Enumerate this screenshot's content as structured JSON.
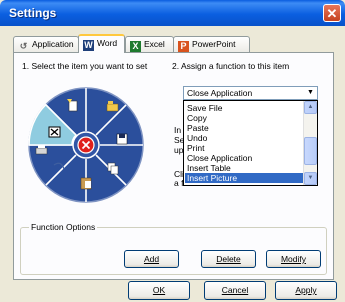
{
  "window": {
    "title": "Settings"
  },
  "tabs": [
    {
      "label": "Application",
      "icon": "application-icon"
    },
    {
      "label": "Word",
      "icon": "word-icon"
    },
    {
      "label": "Excel",
      "icon": "excel-icon"
    },
    {
      "label": "PowerPoint",
      "icon": "powerpoint-icon"
    }
  ],
  "active_tab": "Word",
  "step1_label": "1. Select the item you want to set",
  "step2_label": "2. Assign a function to this item",
  "combo": {
    "value": "Close Application"
  },
  "dropdown_items": [
    "Save File",
    "Copy",
    "Paste",
    "Undo",
    "Print",
    "Close Application",
    "Insert Table",
    "Insert Picture"
  ],
  "dropdown_selected": "Insert Picture",
  "hidden_text": {
    "line1": "In",
    "line2": "Se",
    "line3": "up",
    "line4": "Cli",
    "line5": "a function."
  },
  "function_options": {
    "title": "Function Options",
    "add": "Add",
    "delete": "Delete",
    "modify": "Modify"
  },
  "buttons": {
    "ok": "OK",
    "cancel": "Cancel",
    "apply": "Apply"
  },
  "colors": {
    "wheel": "#3a63b8",
    "wheel_selected": "#8fcce0",
    "center": "#e0201c",
    "title_bar": "#0a5ddf"
  }
}
